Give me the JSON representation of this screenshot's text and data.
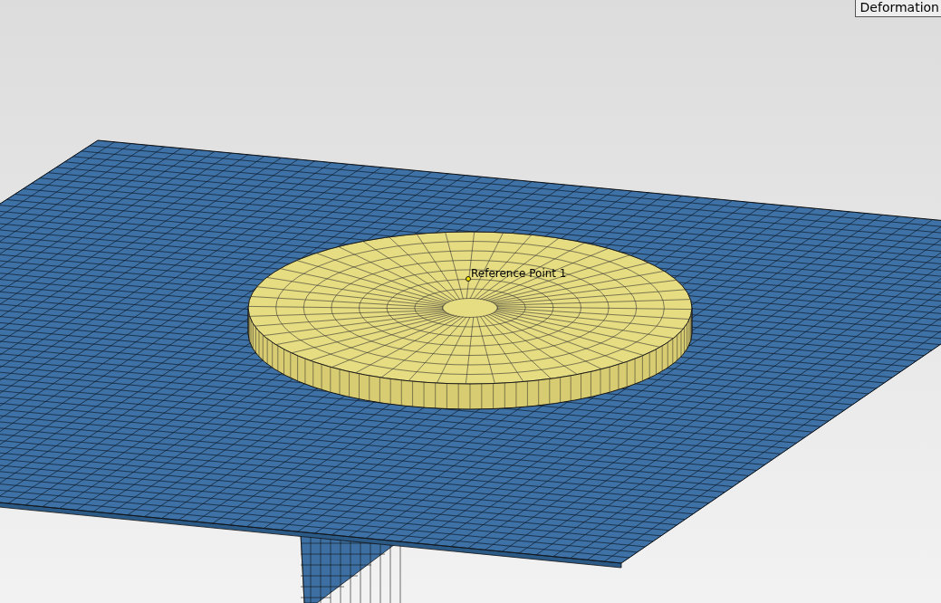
{
  "viewport": {
    "deformation_button": "Deformation",
    "reference_point_label": "Reference Point 1"
  }
}
